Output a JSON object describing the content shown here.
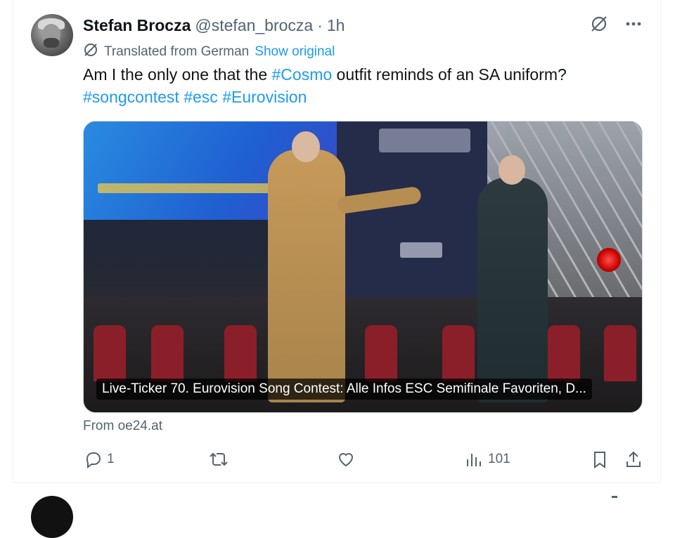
{
  "tweet": {
    "author_name": "Stefan Brocza",
    "handle": "@stefan_brocza",
    "separator": "·",
    "time": "1h",
    "translated_label": "Translated from German",
    "show_original": "Show original",
    "text": {
      "part1": "Am I the only one that the ",
      "tag_cosmo": "#Cosmo",
      "part2": " outfit reminds of an SA uniform?",
      "tag_songcontest": "#songcontest",
      "tag_esc": "#esc",
      "tag_eurovision": "#Eurovision"
    },
    "media_caption": "Live-Ticker 70. Eurovision Song Contest: Alle Infos ESC Semifinale Favoriten, D...",
    "source": "From oe24.at",
    "replies": "1",
    "views": "101"
  },
  "icons": {
    "grok": "grok-icon",
    "more": "more-icon",
    "translate": "translate-icon",
    "reply": "reply-icon",
    "retweet": "retweet-icon",
    "like": "like-icon",
    "views": "views-icon",
    "bookmark": "bookmark-icon",
    "share": "share-icon"
  },
  "colors": {
    "accent": "#1d9bf0",
    "text": "#0f1419",
    "muted": "#536471"
  }
}
